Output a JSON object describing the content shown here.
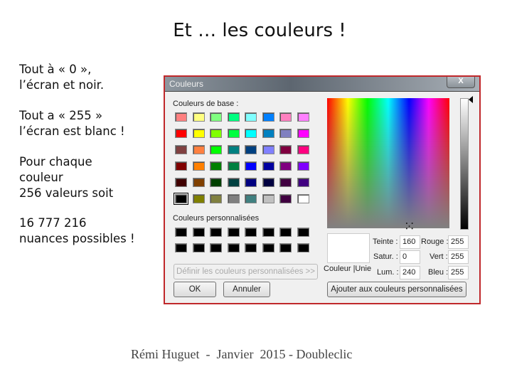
{
  "slide": {
    "title": "Et … les couleurs !",
    "paragraphs": [
      "Tout à « 0 »,\nl’écran et noir.",
      "Tout a « 255 »\nl’écran est blanc !",
      "Pour chaque\ncouleur\n256 valeurs soit",
      "16 777 216\nnuances possibles !"
    ],
    "footer": "Rémi Huguet  -  Janvier  2015 - Doubleclic"
  },
  "dialog": {
    "title": "Couleurs",
    "close_label": "X",
    "base_label": "Couleurs de base :",
    "base_colors": [
      [
        "#ff8080",
        "#ffff80",
        "#80ff80",
        "#00ff80",
        "#80ffff",
        "#0080ff",
        "#ff80c0",
        "#ff80ff"
      ],
      [
        "#ff0000",
        "#ffff00",
        "#80ff00",
        "#00ff40",
        "#00ffff",
        "#0080c0",
        "#8080c0",
        "#ff00ff"
      ],
      [
        "#804040",
        "#ff8040",
        "#00ff00",
        "#008080",
        "#004080",
        "#8080ff",
        "#800040",
        "#ff0080"
      ],
      [
        "#800000",
        "#ff8000",
        "#008000",
        "#008040",
        "#0000ff",
        "#0000a0",
        "#800080",
        "#8000ff"
      ],
      [
        "#400000",
        "#804000",
        "#004000",
        "#004040",
        "#000080",
        "#000040",
        "#400040",
        "#400080"
      ],
      [
        "#000000",
        "#808000",
        "#808040",
        "#808080",
        "#408080",
        "#c0c0c0",
        "#400040",
        "#ffffff"
      ]
    ],
    "selected_base": "#000000",
    "custom_label": "Couleurs personnalisées",
    "custom_colors": [
      "#000000",
      "#000000",
      "#000000",
      "#000000",
      "#000000",
      "#000000",
      "#000000",
      "#000000",
      "#000000",
      "#000000",
      "#000000",
      "#000000",
      "#000000",
      "#000000",
      "#000000",
      "#000000"
    ],
    "define_label": "Définir les couleurs personnalisées >>",
    "ok_label": "OK",
    "cancel_label": "Annuler",
    "solid_label": "Couleur |Unie",
    "hue_label": "Teinte :",
    "hue": "160",
    "sat_label": "Satur. :",
    "sat": "0",
    "lum_label": "Lum. :",
    "lum": "240",
    "red_label": "Rouge :",
    "red": "255",
    "green_label": "Vert :",
    "green": "255",
    "blue_label": "Bleu :",
    "blue": "255",
    "add_label": "Ajouter aux couleurs personnalisées",
    "current_color": "#ffffff"
  }
}
